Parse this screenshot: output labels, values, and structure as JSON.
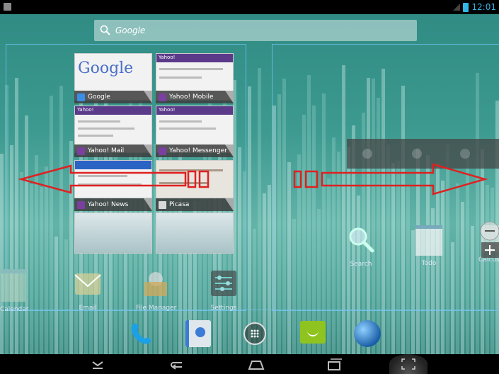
{
  "status_bar": {
    "time": "12:01"
  },
  "search": {
    "text": "Google"
  },
  "recents": [
    {
      "label": "Google",
      "thumb_title": "Google"
    },
    {
      "label": "Yahoo! Mobile",
      "thumb_title": "Yahoo!"
    },
    {
      "label": "Yahoo! Mail",
      "thumb_title": "Yahoo!"
    },
    {
      "label": "Yahoo! Messenger",
      "thumb_title": "Yahoo!"
    },
    {
      "label": "Yahoo! News",
      "thumb_title": ""
    },
    {
      "label": "Picasa",
      "thumb_title": ""
    }
  ],
  "home_apps": [
    {
      "label": "Calendar",
      "icon": "calendar-icon"
    },
    {
      "label": "Email",
      "icon": "email-icon"
    },
    {
      "label": "File Manager",
      "icon": "file-manager-icon"
    },
    {
      "label": "Settings",
      "icon": "settings-icon"
    },
    {
      "label": "Search",
      "icon": "search-icon"
    },
    {
      "label": "Todo",
      "icon": "todo-icon"
    },
    {
      "label": "Calculator",
      "icon": "calculator-icon"
    }
  ],
  "dock": [
    {
      "icon": "phone-icon"
    },
    {
      "icon": "contacts-icon"
    },
    {
      "icon": "app-drawer-icon"
    },
    {
      "icon": "messaging-icon"
    },
    {
      "icon": "browser-icon"
    }
  ],
  "nav": [
    {
      "icon": "hide-keyboard-icon"
    },
    {
      "icon": "back-icon"
    },
    {
      "icon": "home-icon"
    },
    {
      "icon": "recent-apps-icon"
    },
    {
      "icon": "screenshot-icon"
    }
  ],
  "colors": {
    "accent": "#33b5e5",
    "annotation": "#e02020"
  }
}
